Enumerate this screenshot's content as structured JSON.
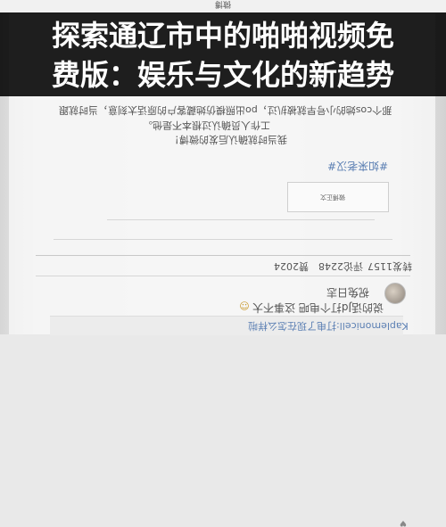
{
  "overlay": {
    "title_line1": "探索通辽市中的啪啪视频免",
    "title_line2": "费版：娱乐与文化的新趋势"
  },
  "screen": {
    "topbar_title": "微博",
    "post": {
      "line1": "那个cos她的小号早就被扒过，po出照模仿她藏客户的原话太刻意，当时就跟",
      "line2": "工作人员确认过根本不是他。",
      "line3": "我当时就确认后发的微博！",
      "hashtag": "#如来老汉#"
    },
    "repost_card": {
      "label": "微博正文"
    },
    "stats": {
      "reposts": "转发1157",
      "comments": "评论2248",
      "likes": "赞2024"
    },
    "comment": {
      "username": "祝兔日志",
      "text": "说的话Jd打个电吧 这事不大",
      "quote": "Kaplemonicell:打电了现在怎么样啦"
    }
  }
}
